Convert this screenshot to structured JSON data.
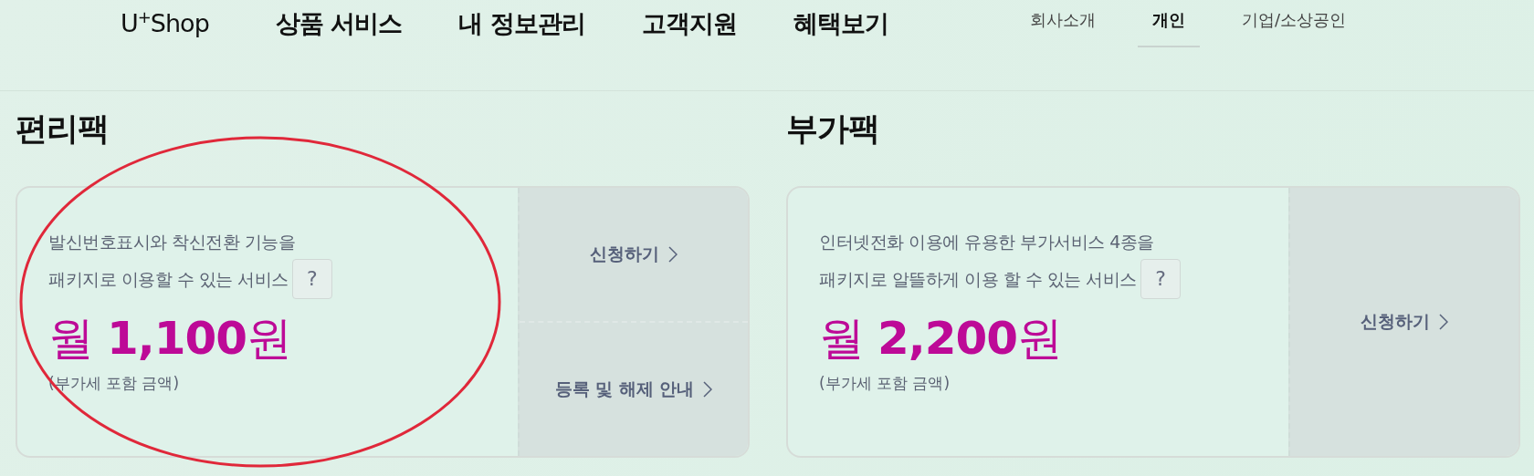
{
  "nav": {
    "logo": "U$^{+}$Shop",
    "items": [
      "상품 서비스",
      "내 정보관리",
      "고객지원",
      "혜택보기"
    ],
    "segments": [
      {
        "label": "회사소개",
        "selected": false
      },
      {
        "label": "개인",
        "selected": true
      },
      {
        "label": "기업/소상공인",
        "selected": false
      }
    ]
  },
  "sections": [
    {
      "title": "편리팩",
      "description": [
        "발신번호표시와 착신전환 기능을",
        "패키지로 이용할 수 있는 서비스"
      ],
      "help": "?",
      "price": "월 **1,100**원",
      "note": "(부가세 포함 금액)",
      "actions": [
        "신청하기",
        "등록 및 해제 안내"
      ]
    },
    {
      "title": "부가팩",
      "description": [
        "인터넷전화 이용에 유용한 부가서비스 4종을",
        "패키지로 알뜰하게 이용 할 수 있는 서비스"
      ],
      "help": "?",
      "price": "월 **2,200**원",
      "note": "(부가세 포함 금액)",
      "actions": [
        "신청하기"
      ]
    }
  ]
}
